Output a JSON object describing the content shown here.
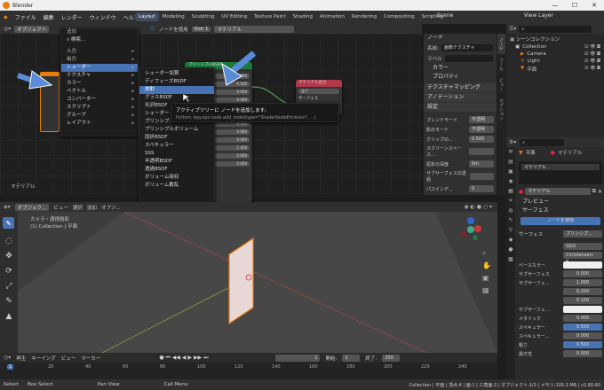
{
  "window": {
    "title": "Blender",
    "controls": [
      "—",
      "☐",
      "✕"
    ]
  },
  "menu": [
    "ファイル",
    "編集",
    "レンダー",
    "ウィンドウ",
    "ヘルプ"
  ],
  "workspaces": [
    "Layout",
    "Modeling",
    "Sculpting",
    "UV Editing",
    "Texture Paint",
    "Shading",
    "Animation",
    "Rendering",
    "Compositing",
    "Scripting"
  ],
  "scene": {
    "label": "Scene",
    "view_layer": "View Layer"
  },
  "node_header": {
    "editor": "オブジェクト",
    "use_nodes": "ノードを使用",
    "slot": "Slot 1",
    "material": "マテリアル"
  },
  "add_menu": {
    "title": "追加",
    "search": "検索...",
    "items": [
      {
        "label": "入力",
        "sub": true
      },
      {
        "label": "出力",
        "sub": true
      },
      {
        "label": "シェーダー",
        "sub": true
      },
      {
        "label": "テクスチャ",
        "sub": true
      },
      {
        "label": "カラー",
        "sub": true
      },
      {
        "label": "ベクトル",
        "sub": true
      },
      {
        "label": "コンバーター",
        "sub": true
      },
      {
        "label": "スクリプト",
        "sub": true
      },
      {
        "label": "グループ",
        "sub": true
      },
      {
        "label": "レイアウト",
        "sub": true
      }
    ]
  },
  "shader_menu": [
    "シェーダー加算",
    "ディフューズBSDF",
    "放射",
    "グラスBSDF",
    "光沢BSDF",
    "シェーダー...",
    "プリンシプルBSDF",
    "プリンシプルボリューム",
    "屈折BSDF",
    "スペキュラー",
    "SSS",
    "半透明BSDF",
    "透過BSDF",
    "ボリューム吸収",
    "ボリューム散乱"
  ],
  "tooltip": {
    "title": "アクティブツリーに ノードを追加します。",
    "python": "Python: bpy.ops.node.add_node(type=\"ShaderNodeEmission\", ...)"
  },
  "node_labels": {
    "principled": "プリンシプルBSDF",
    "output": "マテリアル出力",
    "output_all": "全て",
    "output_surface": "サーフェス",
    "output_volume": "ボリューム",
    "output_disp": "ディスプレイスメント",
    "material_label": "マテリアル",
    "node_values": [
      "0.000",
      "0.500",
      "0.000",
      "0.000",
      "0.500",
      "0.000",
      "0.500",
      "0.000",
      "0.000",
      "1.450",
      "0.000",
      "0.000"
    ]
  },
  "n_panel": {
    "node_title": "ノード",
    "name_label": "名前:",
    "name_value": "画像テクスチャ",
    "label_label": "ラベル",
    "color": "カラー",
    "props": "プロパティ",
    "tex_map": "テクスチャマッピング",
    "annotation": "アノテーション",
    "settings": "設定",
    "rows": [
      {
        "label": "ブレンドモード",
        "value": "不透明"
      },
      {
        "label": "影のモード",
        "value": "不透明"
      },
      {
        "label": "クリップの...",
        "value": "0.500"
      },
      {
        "label": "スクリーンスペース...",
        "value": ""
      },
      {
        "label": "屈折の深度",
        "value": "0m"
      },
      {
        "label": "サブサーフェスの透過",
        "value": ""
      },
      {
        "label": "パスインデ...",
        "value": "0"
      }
    ],
    "tabs": [
      "ノード",
      "ツール",
      "ビュー",
      "オプション"
    ]
  },
  "outliner": {
    "root": "シーンコレクション",
    "items": [
      {
        "name": "Collection",
        "level": 1
      },
      {
        "name": "Camera",
        "level": 2
      },
      {
        "name": "Light",
        "level": 2
      },
      {
        "name": "平面",
        "level": 2
      }
    ]
  },
  "properties": {
    "object": "平面",
    "material_tab": "マテリアル",
    "slot": "マテリアル",
    "mat_name": "マテリアル",
    "preview": "プレビュー",
    "surface": "サーフェス",
    "use_nodes": "ノードを使用",
    "surface_label": "サーフェス",
    "surface_value": "プリンシプ...",
    "dist": "GGX",
    "sss_method": "Christensen-B...",
    "rows": [
      {
        "label": "ベースカラー",
        "value": ""
      },
      {
        "label": "サブサーフェス",
        "value": "0.000"
      },
      {
        "label": "サブサーフェ...",
        "value": "1.000"
      },
      {
        "label": "",
        "value": "0.200"
      },
      {
        "label": "",
        "value": "0.100"
      },
      {
        "label": "サブサーフェ...",
        "value": ""
      },
      {
        "label": "メタリック",
        "value": "0.000"
      },
      {
        "label": "スペキュラー",
        "value": "0.500"
      },
      {
        "label": "スペキュラー...",
        "value": "0.000"
      },
      {
        "label": "粗さ",
        "value": "0.500"
      },
      {
        "label": "異方性",
        "value": "0.000"
      }
    ]
  },
  "viewport": {
    "header": [
      "オブジェク...",
      "ビュー",
      "選択",
      "追加",
      "オブジ..."
    ],
    "info_1": "カメラ・透視投影",
    "info_2": "(1) Collection | 平面",
    "material_label": "マテリアル"
  },
  "timeline": {
    "menu": [
      "再生",
      "キーイング",
      "ビュー",
      "マーカー"
    ],
    "frame": "1",
    "start_label": "開始:",
    "start": "1",
    "end_label": "終了:",
    "end": "250",
    "ticks": [
      "0",
      "20",
      "40",
      "60",
      "80",
      "100",
      "120",
      "140",
      "160",
      "180",
      "200",
      "220",
      "240"
    ]
  },
  "status": {
    "items": [
      "Select",
      "Box Select",
      "Pan View",
      "Call Menu"
    ],
    "info": "Collection | 平面 | 頂点:4 | 面:1 | 三角面:2 | オブジェクト:1/3 | メモリ:105.3 MB | v2.80.60"
  },
  "colors": {
    "accent": "#4772b3",
    "orange": "#e87d0d",
    "node_green": "#1b7a3b",
    "node_red": "#b3384a",
    "arrow": "#5a8bd8"
  }
}
